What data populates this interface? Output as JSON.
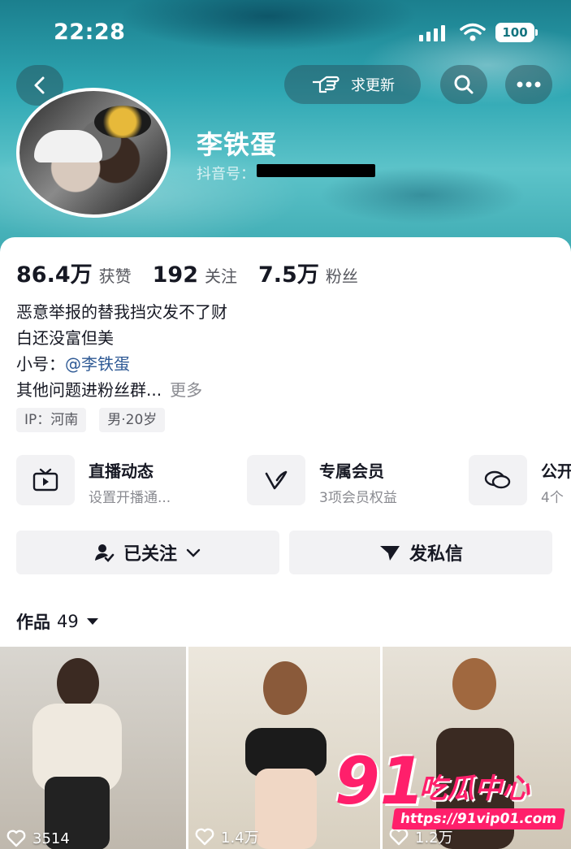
{
  "status_bar": {
    "time": "22:28",
    "battery": "100"
  },
  "header": {
    "request_update_label": "求更新"
  },
  "profile": {
    "name": "李铁蛋",
    "douyin_id_label": "抖音号："
  },
  "stats": [
    {
      "value": "86.4万",
      "label": "获赞"
    },
    {
      "value": "192",
      "label": "关注"
    },
    {
      "value": "7.5万",
      "label": "粉丝"
    }
  ],
  "bio": {
    "line1": "恶意举报的替我挡灾发不了财",
    "line2": "白还没富但美",
    "alt_prefix": "小号：",
    "alt_handle": "@李铁蛋",
    "line4": "其他问题进粉丝群...",
    "more": "更多"
  },
  "tags": [
    "IP：河南",
    "男·20岁"
  ],
  "features": [
    {
      "title": "直播动态",
      "subtitle": "设置开播通...",
      "icon": "tv-icon"
    },
    {
      "title": "专属会员",
      "subtitle": "3项会员权益",
      "icon": "v-badge-icon"
    },
    {
      "title": "公开",
      "subtitle": "4个",
      "icon": "chat-bubbles-icon"
    }
  ],
  "actions": {
    "follow_label": "已关注",
    "message_label": "发私信"
  },
  "works": {
    "label": "作品",
    "count": "49"
  },
  "videos": [
    {
      "likes": "3514"
    },
    {
      "likes": "1.4万"
    },
    {
      "likes": "1.2万"
    }
  ],
  "watermark": {
    "number": "91",
    "brand": "吃瓜中心",
    "url": "https://91vip01.com"
  }
}
